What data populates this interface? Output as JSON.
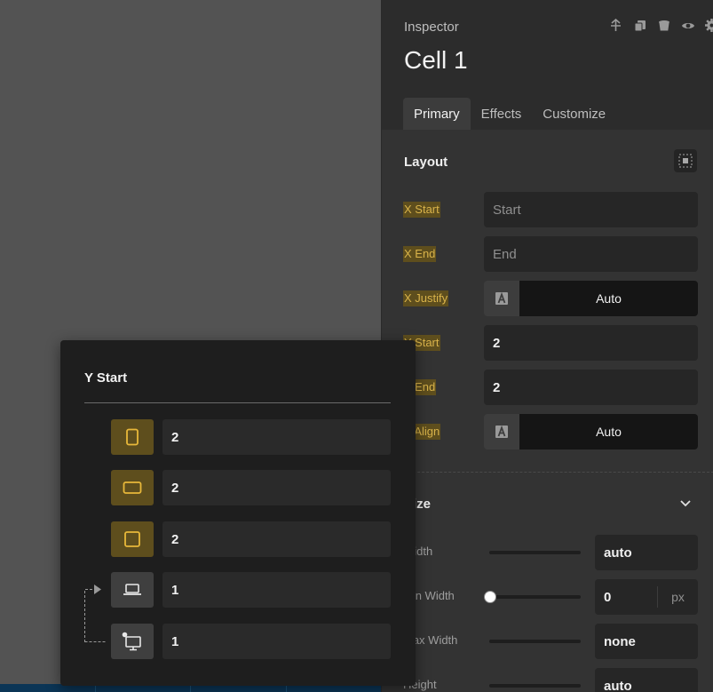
{
  "inspector": {
    "label": "Inspector",
    "title": "Cell 1",
    "actions": [
      "pin-icon",
      "copy-icon",
      "trash-icon",
      "eye-icon",
      "gear-icon"
    ],
    "tabs": [
      {
        "label": "Primary",
        "active": true
      },
      {
        "label": "Effects",
        "active": false
      },
      {
        "label": "Customize",
        "active": false
      }
    ]
  },
  "layout": {
    "title": "Layout",
    "rows": {
      "x_start": {
        "label": "X Start",
        "placeholder": "Start"
      },
      "x_end": {
        "label": "X End",
        "placeholder": "End"
      },
      "x_justify": {
        "label": "X Justify",
        "value": "Auto"
      },
      "y_start": {
        "label": "Y Start",
        "value": "2"
      },
      "y_end": {
        "label": "Y End",
        "value": "2"
      },
      "y_align": {
        "label": "Y Align",
        "value": "Auto"
      }
    }
  },
  "size": {
    "title": "Size",
    "width": {
      "label": "Width",
      "value": "auto"
    },
    "min_width": {
      "label": "Min Width",
      "value": "0",
      "unit": "px"
    },
    "max_width": {
      "label": "Max Width",
      "value": "none"
    },
    "height": {
      "label": "Height",
      "value": "auto"
    }
  },
  "popover": {
    "title": "Y Start",
    "breakpoints": [
      {
        "icon": "tablet-portrait-icon",
        "value": "2",
        "active": true
      },
      {
        "icon": "tablet-landscape-icon",
        "value": "2",
        "active": true
      },
      {
        "icon": "square-icon",
        "value": "2",
        "active": true
      },
      {
        "icon": "laptop-icon",
        "value": "1",
        "active": false
      },
      {
        "icon": "desktop-icon",
        "value": "1",
        "active": false
      }
    ]
  },
  "colors": {
    "accent": "#e8b83a",
    "accent_bg": "#5e4e1d",
    "panel": "#333333",
    "popover": "#1e1e1e"
  }
}
